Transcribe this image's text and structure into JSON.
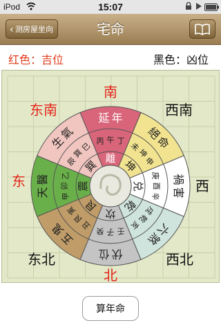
{
  "status": {
    "carrier": "iPod",
    "time": "15:07"
  },
  "nav": {
    "back_label": "测房屋坐向",
    "title": "宅命"
  },
  "legend": {
    "good": "红色：吉位",
    "bad": "黑色：凶位"
  },
  "compass": {
    "directions": {
      "south": "南",
      "southwest": "西南",
      "west": "西",
      "northwest": "西北",
      "north": "北",
      "northeast": "东北",
      "east": "东",
      "southeast": "东南"
    },
    "sectors": [
      {
        "key": "south",
        "star": "延年",
        "trigram": "離",
        "stems": "丙午丁",
        "color": "#d9657a",
        "good": true
      },
      {
        "key": "southwest",
        "star": "絕命",
        "trigram": "坤",
        "stems": "未坤申",
        "color": "#f1e38f",
        "good": false
      },
      {
        "key": "west",
        "star": "禍害",
        "trigram": "兑",
        "stems": "庚酉辛",
        "color": "#ffffff",
        "good": false
      },
      {
        "key": "northwest",
        "star": "六煞",
        "trigram": "乾",
        "stems": "戌乾亥",
        "color": "#cfe4dc",
        "good": false
      },
      {
        "key": "north",
        "star": "伏位",
        "trigram": "坎",
        "stems": "壬子癸",
        "color": "#c4c4c4",
        "good": true
      },
      {
        "key": "northeast",
        "star": "五鬼",
        "trigram": "艮",
        "stems": "丑艮寅",
        "color": "#bf9c68",
        "good": false
      },
      {
        "key": "east",
        "star": "天醫",
        "trigram": "震",
        "stems": "甲卯乙",
        "color": "#6ab04a",
        "good": true
      },
      {
        "key": "southeast",
        "star": "生氣",
        "trigram": "巽",
        "stems": "辰巽巳",
        "color": "#f2c6c0",
        "good": true
      }
    ]
  },
  "bottom": {
    "button_label": "算年命"
  }
}
